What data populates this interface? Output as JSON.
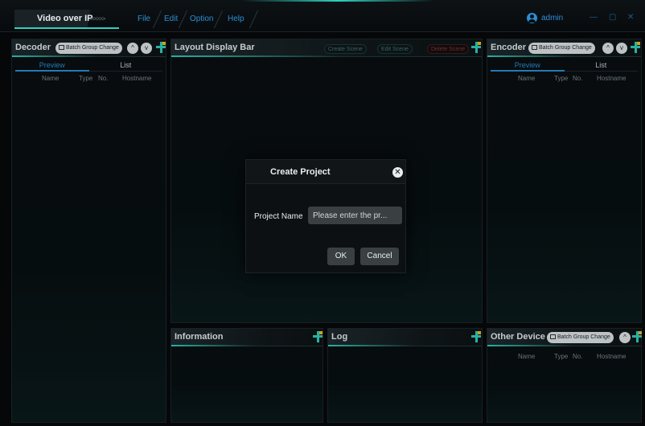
{
  "app": {
    "title": "Video over IP",
    "title_arrows": ">>>>>",
    "user": "admin",
    "minimize_glyph": "—",
    "maximize_glyph": "▢",
    "close_glyph": "✕"
  },
  "menu": [
    "File",
    "Edit",
    "Option",
    "Help"
  ],
  "decoder": {
    "title": "Decoder",
    "batch_label": "Batch Group Change",
    "up_glyph": "^",
    "down_glyph": "v",
    "tabs": [
      "Preview",
      "List"
    ],
    "columns": [
      "Name",
      "Type",
      "No.",
      "Hostname"
    ]
  },
  "layout": {
    "title": "Layout Display Bar",
    "create_scene": "Create Scene",
    "edit_scene": "Edit Scene",
    "delete_scene": "Delete Scene"
  },
  "encoder": {
    "title": "Encoder",
    "batch_label": "Batch Group Change",
    "up_glyph": "^",
    "down_glyph": "v",
    "tabs": [
      "Preview",
      "List"
    ],
    "columns": [
      "Name",
      "Type",
      "No.",
      "Hostname"
    ]
  },
  "information": {
    "title": "Information"
  },
  "log": {
    "title": "Log"
  },
  "other_device": {
    "title": "Other Device",
    "batch_label": "Batch Group Change",
    "up_glyph": "^",
    "columns": [
      "Name",
      "Type",
      "No.",
      "Hostname"
    ]
  },
  "dialog": {
    "title": "Create Project",
    "close_glyph": "✕",
    "field_label": "Project Name",
    "placeholder": "Please enter the pr...",
    "ok_label": "OK",
    "cancel_label": "Cancel"
  },
  "colors": {
    "accent_teal": "#2fd0c0",
    "accent_blue": "#2a8fd6",
    "accent_yellow": "#f0c020",
    "background": "#07090b"
  }
}
